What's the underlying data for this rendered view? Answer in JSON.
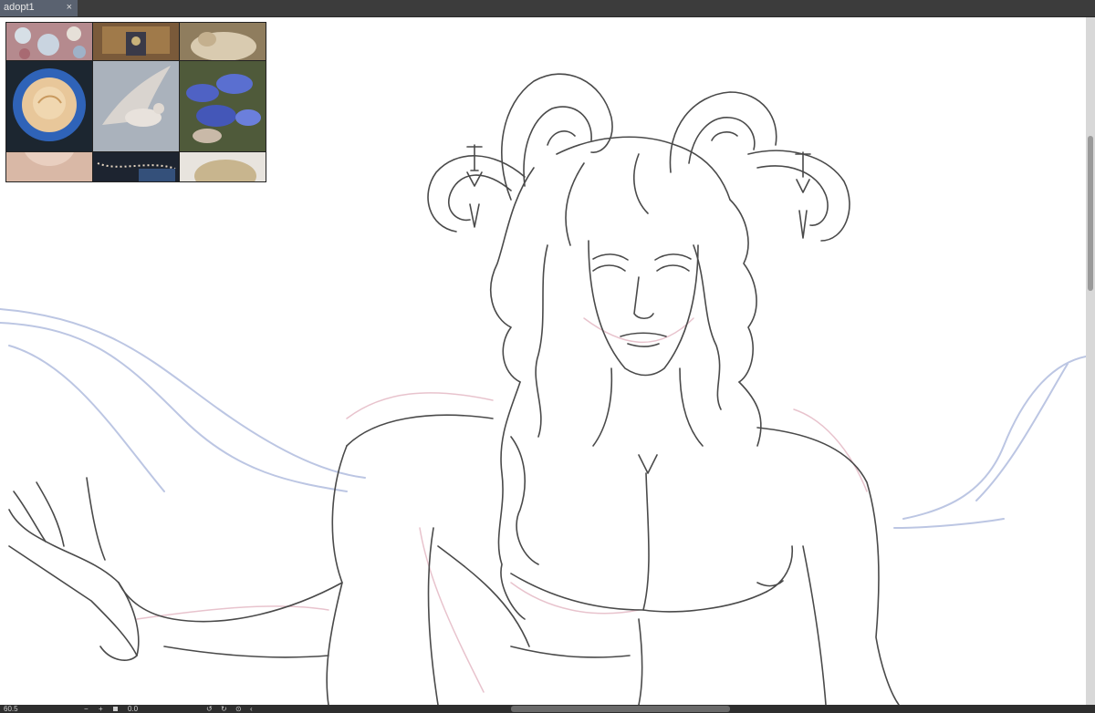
{
  "tabs": [
    {
      "label": "adopt1",
      "close_glyph": "×"
    }
  ],
  "status": {
    "zoom": "60.5",
    "angle": "0.0",
    "minus_glyph": "−",
    "plus_glyph": "+"
  },
  "colors": {
    "accent_tab": "#5a6270",
    "ui_dark": "#3a3a3a",
    "canvas": "#ffffff",
    "sketch_red": "#e3b7c3",
    "sketch_blue": "#bcc6e3",
    "line_art": "#4a4a4a"
  },
  "icons": [
    "close-icon",
    "zoom-out-icon",
    "zoom-in-icon",
    "fit-icon",
    "rotate-left-icon",
    "rotate-right-icon",
    "reset-rotation-icon",
    "scroll-left-icon"
  ],
  "reference_images": [
    "gemstones",
    "ornate-jewelry",
    "sheep",
    "glitter-rose",
    "dove-in-flight",
    "blue-mushrooms",
    "neck-and-shoulders",
    "pearl-strands",
    "blond-curls"
  ]
}
